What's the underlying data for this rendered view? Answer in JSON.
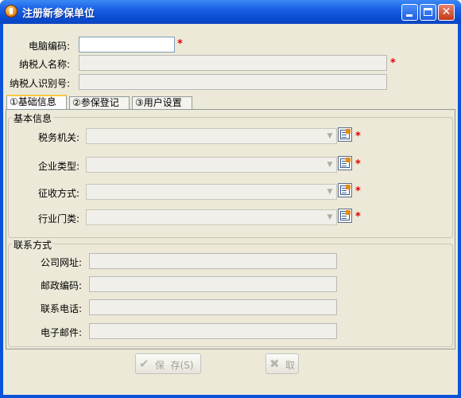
{
  "window": {
    "title": "注册新参保单位",
    "app_icon": "app-logo-icon"
  },
  "header_fields": {
    "computer_code_label": "电脑编码:",
    "taxpayer_name_label": "纳税人名称:",
    "taxpayer_id_label": "纳税人识别号:",
    "computer_code_value": "",
    "taxpayer_name_value": "",
    "taxpayer_id_value": "",
    "required_mark": "*"
  },
  "tabs": [
    {
      "label": "①基础信息",
      "active": true
    },
    {
      "label": "②参保登记",
      "active": false
    },
    {
      "label": "③用户设置",
      "active": false
    }
  ],
  "basic_info": {
    "title": "基本信息",
    "rows": [
      {
        "label": "税务机关:",
        "value": ""
      },
      {
        "label": "企业类型:",
        "value": ""
      },
      {
        "label": "征收方式:",
        "value": ""
      },
      {
        "label": "行业门类:",
        "value": ""
      }
    ]
  },
  "contact": {
    "title": "联系方式",
    "rows": [
      {
        "label": "公司网址:",
        "value": ""
      },
      {
        "label": "邮政编码:",
        "value": ""
      },
      {
        "label": "联系电话:",
        "value": ""
      },
      {
        "label": "电子邮件:",
        "value": ""
      }
    ]
  },
  "buttons": {
    "save_label": "保  存(S)",
    "cancel_label": "取"
  },
  "colors": {
    "title_bar": "#0a52d8",
    "dialog_bg": "#ece9d8",
    "required": "#e00000"
  }
}
